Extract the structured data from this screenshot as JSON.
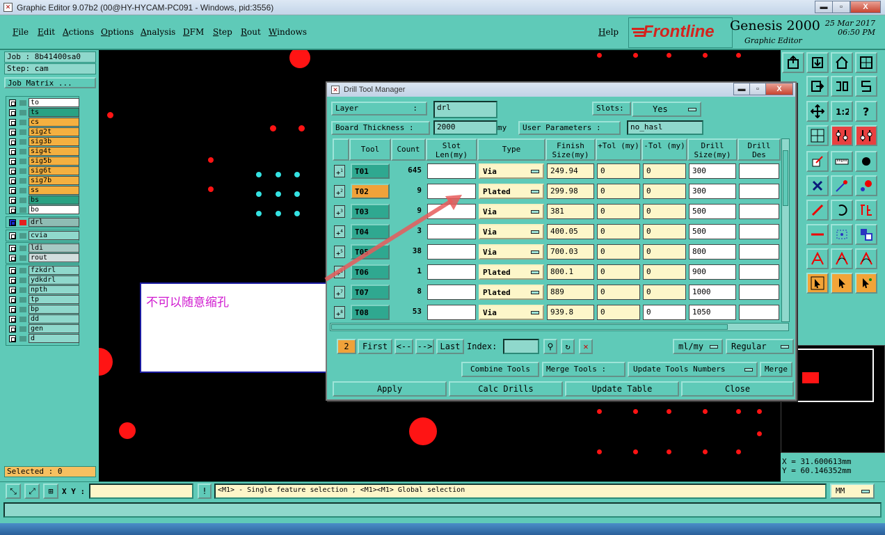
{
  "window": {
    "title": "Graphic Editor 9.07b2 (00@HY-HYCAM-PC091 - Windows, pid:3556)",
    "min": "▬",
    "max": "▫",
    "close": "X"
  },
  "menu": {
    "items": [
      "File",
      "Edit",
      "Actions",
      "Options",
      "Analysis",
      "DFM",
      "Step",
      "Rout",
      "Windows"
    ],
    "help": "Help"
  },
  "brand": {
    "logo": "Frontline",
    "product": "Genesis 2000",
    "subtitle": "Graphic Editor",
    "date": "25 Mar 2017",
    "time": "06:50 PM"
  },
  "left": {
    "job": "Job : 8b41400sa0",
    "step": "Step: cam",
    "job_matrix": "Job Matrix ...",
    "selected": "Selected : 0",
    "layers_group1": [
      {
        "name": "to",
        "color": "#ffffff"
      },
      {
        "name": "ts",
        "color": "#2aa283"
      },
      {
        "name": "cs",
        "color": "#f4b040"
      },
      {
        "name": "sig2t",
        "color": "#f4b040"
      },
      {
        "name": "sig3b",
        "color": "#f4b040"
      },
      {
        "name": "sig4t",
        "color": "#f4b040"
      },
      {
        "name": "sig5b",
        "color": "#f4b040"
      },
      {
        "name": "sig6t",
        "color": "#f4b040"
      },
      {
        "name": "sig7b",
        "color": "#f4b040"
      },
      {
        "name": "ss",
        "color": "#f4b040"
      },
      {
        "name": "bs",
        "color": "#2aa283"
      },
      {
        "name": "bo",
        "color": "#ffffff"
      }
    ],
    "drl_layer": "drl",
    "layers_group2": [
      "cvia"
    ],
    "layers_group3": [
      "ldi",
      "rout"
    ],
    "layers_group4": [
      "fzkdrl",
      "ydkdrl",
      "npth",
      "tp",
      "bp",
      "dd",
      "gen",
      "d"
    ]
  },
  "annotation": {
    "text": "不可以随意缩孔"
  },
  "dialog": {
    "title": "Drill Tool Manager",
    "layer_label": "Layer",
    "layer_sep": ":",
    "layer_value": "drl",
    "slots_label": "Slots:",
    "slots_value": "Yes",
    "board_thickness_label": "Board Thickness :",
    "board_thickness_value": "2000",
    "board_thickness_unit": "my",
    "user_params_label": "User Parameters :",
    "user_params_value": "no_hasl",
    "columns": [
      "Tool",
      "Count",
      "Slot Len(my)",
      "Type",
      "Finish Size(my)",
      "+Tol (my)",
      "-Tol (my)",
      "Drill Size(my)",
      "Drill Des"
    ],
    "rows": [
      {
        "icon": "1",
        "tool": "T01",
        "count": "645",
        "type": "Via",
        "finish": "249.94",
        "ptol": "0",
        "mtol": "0",
        "drill": "300"
      },
      {
        "icon": "2",
        "tool": "T02",
        "count": "9",
        "type": "Plated",
        "finish": "299.98",
        "ptol": "0",
        "mtol": "0",
        "drill": "300"
      },
      {
        "icon": "3",
        "tool": "T03",
        "count": "9",
        "type": "Via",
        "finish": "381",
        "ptol": "0",
        "mtol": "0",
        "drill": "500"
      },
      {
        "icon": "4",
        "tool": "T04",
        "count": "3",
        "type": "Via",
        "finish": "400.05",
        "ptol": "0",
        "mtol": "0",
        "drill": "500"
      },
      {
        "icon": "5",
        "tool": "T05",
        "count": "38",
        "type": "Via",
        "finish": "700.03",
        "ptol": "0",
        "mtol": "0",
        "drill": "800"
      },
      {
        "icon": "6",
        "tool": "T06",
        "count": "1",
        "type": "Plated",
        "finish": "800.1",
        "ptol": "0",
        "mtol": "0",
        "drill": "900"
      },
      {
        "icon": "7",
        "tool": "T07",
        "count": "8",
        "type": "Plated",
        "finish": "889",
        "ptol": "0",
        "mtol": "0",
        "drill": "1000"
      },
      {
        "icon": "8",
        "tool": "T08",
        "count": "53",
        "type": "Via",
        "finish": "939.8",
        "ptol": "0",
        "mtol": "0",
        "drill": "1050"
      }
    ],
    "page_num": "2",
    "first": "First",
    "prev": "<--",
    "next": "-->",
    "last": "Last",
    "index_label": "Index:",
    "units": "ml/my",
    "mode": "Regular",
    "combine": "Combine Tools",
    "merge_label": "Merge Tools :",
    "update_numbers": "Update Tools Numbers",
    "merge": "Merge",
    "apply": "Apply",
    "calc": "Calc Drills",
    "update_table": "Update Table",
    "close": "Close"
  },
  "status": {
    "xy_label": "X Y :",
    "message": "<M1> - Single feature selection ; <M1><M1> Global selection",
    "units": "MM"
  },
  "coords": {
    "x": "X = 31.600613mm",
    "y": "Y = 60.146352mm"
  }
}
